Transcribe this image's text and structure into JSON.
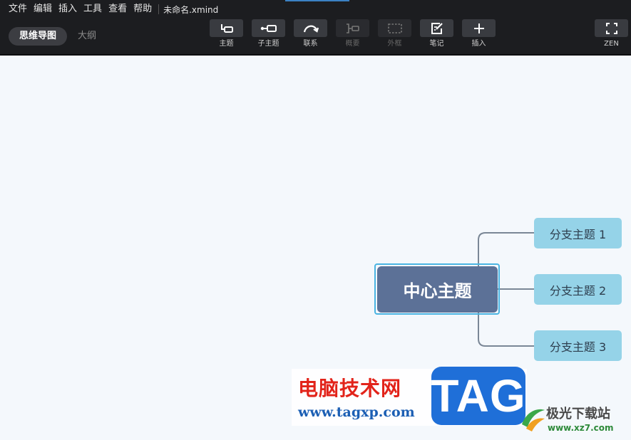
{
  "menubar": {
    "items": [
      "文件",
      "编辑",
      "插入",
      "工具",
      "查看",
      "帮助"
    ],
    "filename": "未命名.xmind"
  },
  "view_tabs": [
    {
      "label": "思维导图",
      "active": true
    },
    {
      "label": "大纲",
      "active": false
    }
  ],
  "toolbar": {
    "topic": {
      "label": "主题",
      "icon": "topic-icon"
    },
    "subtopic": {
      "label": "子主题",
      "icon": "subtopic-icon"
    },
    "relationship": {
      "label": "联系",
      "icon": "relationship-icon"
    },
    "summary": {
      "label": "概要",
      "icon": "summary-icon",
      "enabled": false
    },
    "boundary": {
      "label": "外框",
      "icon": "boundary-icon",
      "enabled": false
    },
    "note": {
      "label": "笔记",
      "icon": "note-icon"
    },
    "insert": {
      "label": "插入",
      "icon": "plus-icon"
    },
    "zen": {
      "label": "ZEN",
      "icon": "fullscreen-icon"
    }
  },
  "mindmap": {
    "central_topic": "中心主题",
    "branches": [
      "分支主题 1",
      "分支主题 2",
      "分支主题 3"
    ]
  },
  "watermark": {
    "site_name": "电脑技术网",
    "site_url": "www.tagxp.com",
    "tag_logo": "TAG",
    "site2_name": "极光下载站",
    "site2_url": "www.xz7.com"
  },
  "colors": {
    "toolbar_bg": "#1c1d20",
    "canvas_bg": "#f4f8fc",
    "central_topic": "#5c7197",
    "branch_topic": "#95d3e8",
    "selection": "#4ab4e2",
    "connector": "#7a8796"
  }
}
